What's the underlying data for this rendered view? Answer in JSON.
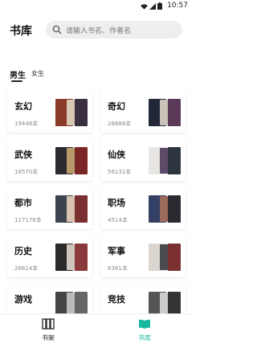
{
  "status": {
    "time": "10:57"
  },
  "header": {
    "title": "书库",
    "search_placeholder": "请输入书名、作者名"
  },
  "tabs": [
    {
      "label": "男生",
      "active": true
    },
    {
      "label": "女生",
      "active": false
    }
  ],
  "categories": [
    {
      "name": "玄幻",
      "count": "19446本",
      "colors": [
        "#8a3b2a",
        "#d7c8b4",
        "#3a3040"
      ]
    },
    {
      "name": "奇幻",
      "count": "26886本",
      "colors": [
        "#222838",
        "#c9c2b8",
        "#5a3a58"
      ]
    },
    {
      "name": "武侠",
      "count": "18570本",
      "colors": [
        "#2b2b2f",
        "#b89a6a",
        "#7a2626"
      ]
    },
    {
      "name": "仙侠",
      "count": "56131本",
      "colors": [
        "#e8e6e2",
        "#5f4a6a",
        "#2d3640"
      ]
    },
    {
      "name": "都市",
      "count": "117178本",
      "colors": [
        "#3d4450",
        "#d9c2b0",
        "#7b3030"
      ]
    },
    {
      "name": "职场",
      "count": "4514本",
      "colors": [
        "#354066",
        "#9a6b5a",
        "#2a2a30"
      ]
    },
    {
      "name": "历史",
      "count": "26614本",
      "colors": [
        "#2a2a2a",
        "#cfc6bd",
        "#8a3a3a"
      ]
    },
    {
      "name": "军事",
      "count": "6361本",
      "colors": [
        "#dcd6d0",
        "#4a4a50",
        "#7c2f2f"
      ]
    },
    {
      "name": "游戏",
      "count": "",
      "colors": [
        "#444",
        "#bbb",
        "#666"
      ]
    },
    {
      "name": "竞技",
      "count": "",
      "colors": [
        "#555",
        "#ccc",
        "#333"
      ]
    }
  ],
  "nav": {
    "shelf_label": "书架",
    "library_label": "书库"
  },
  "accent": "#19b8a0"
}
